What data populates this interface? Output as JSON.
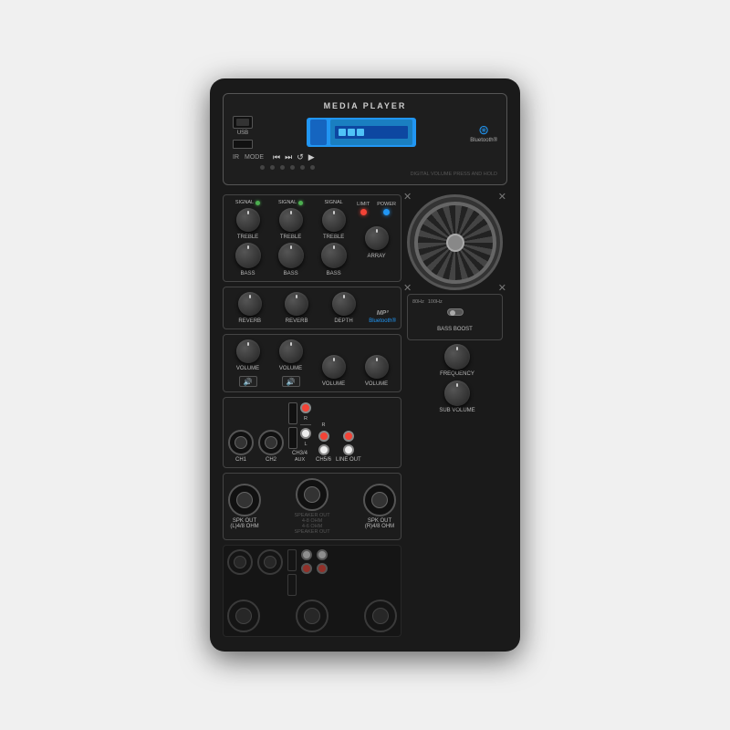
{
  "panel": {
    "title": "MEDIA PLAYER",
    "usb_label": "USB",
    "bluetooth_label": "Bluetooth®",
    "ir_label": "IR",
    "mode_label": "MODE",
    "digital_vol_label": "DIGITAL VOLUME PRESS AND HOLD",
    "signal_label": "SIGNAL",
    "limit_label": "LIMIT",
    "power_label": "POWER",
    "array_label": "ARRAY",
    "treble_labels": [
      "TREBLE",
      "TREBLE",
      "TREBLE"
    ],
    "bass_labels": [
      "BASS",
      "BASS",
      "BASS"
    ],
    "reverb_labels": [
      "REVERB",
      "REVERB",
      "DEPTH"
    ],
    "volume_labels": [
      "VOLUME",
      "VOLUME",
      "VOLUME",
      "VOLUME"
    ],
    "sub_volume_label": "SUB VOLUME",
    "bass_boost_label": "BASS BOOST",
    "freq_80hz": "80Hz",
    "freq_100hz": "100Hz",
    "frequency_label": "FREQUENCY",
    "ch_labels": [
      "CH1",
      "CH2",
      "CH3/4",
      "CH5/6",
      "LINE OUT"
    ],
    "aux_label": "AUX",
    "spk_out_l": "SPK OUT\n(L)4/8 OHM",
    "spk_out_r": "SPK OUT\n(R)4/8 OHM",
    "speaker_out_label": "SPEAKER OUT\n4-8 OHM\n4-6 OHM\nSPEAKER OUT",
    "mp3_label": "MP3",
    "bluetooth_small": "Bluetooth®"
  }
}
